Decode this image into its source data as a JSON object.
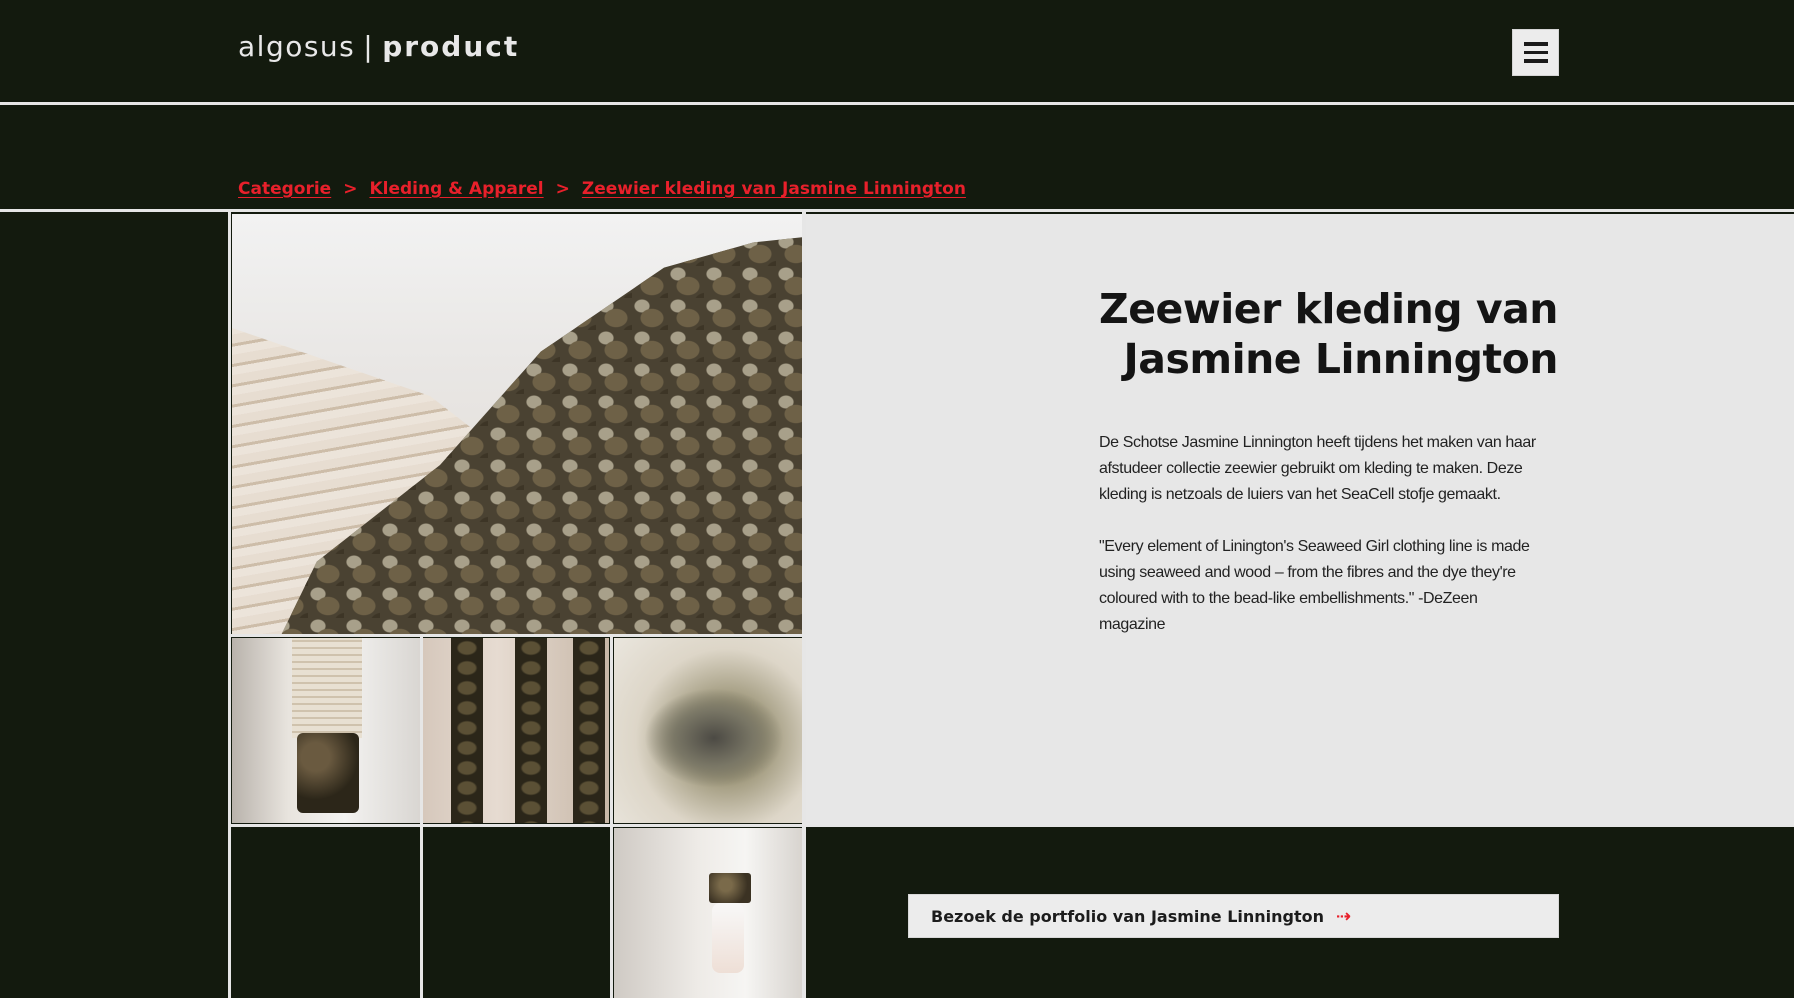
{
  "header": {
    "brand": "algosus",
    "separator": "|",
    "section": "product",
    "menu_icon": "hamburger-menu-icon"
  },
  "breadcrumb": {
    "items": [
      "Categorie",
      "Kleding & Apparel",
      "Zeewier kleding van Jasmine Linnington"
    ],
    "separator": ">"
  },
  "product": {
    "title_line1": "Zeewier kleding van",
    "title_line2": "Jasmine Linnington",
    "description": "De Schotse Jasmine Linnington heeft tijdens het maken van haar afstudeer collectie zeewier gebruikt om kleding te maken. Deze kleding is netzoals de luiers van het SeaCell stofje gemaakt.",
    "quote": "\"Every element of Linington's Seaweed Girl clothing line is made using seaweed and wood – from the fibres and the dye they're coloured with to the bead-like embellishments.\" -DeZeen magazine"
  },
  "portfolio_button": {
    "label": "Bezoek de portfolio van Jasmine Linnington",
    "arrow": "⇢",
    "icon": "arrow-right-icon"
  },
  "colors": {
    "background": "#131a0e",
    "accent": "#e8202b",
    "panel": "#e7e7e7"
  }
}
